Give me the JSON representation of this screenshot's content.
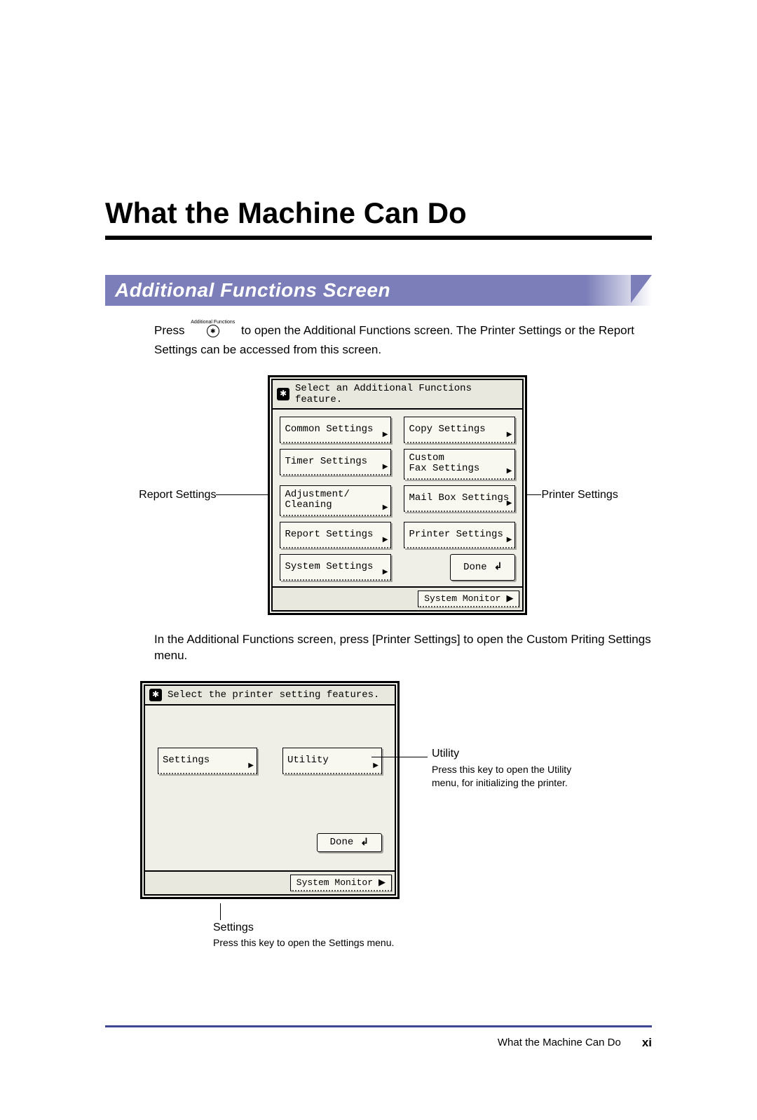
{
  "title": "What the Machine Can Do",
  "section_heading": "Additional Functions Screen",
  "intro_a": "Press",
  "intro_b": "to open the Additional Functions screen. The Printer Settings or the Report Settings can be accessed from this screen.",
  "icon_label": "Additional Functions",
  "callouts": {
    "report_settings": "Report Settings",
    "printer_settings": "Printer Settings"
  },
  "lcd1": {
    "header": "Select an Additional Functions feature.",
    "buttons": [
      "Common Settings",
      "Copy Settings",
      "Timer Settings",
      "Custom\nFax Settings",
      "Adjustment/\nCleaning",
      "Mail Box Settings",
      "Report Settings",
      "Printer Settings",
      "System Settings"
    ],
    "done": "Done",
    "system_monitor": "System Monitor"
  },
  "mid_text": "In the Additional Functions screen, press [Printer Settings] to open the Custom Priting Settings menu.",
  "lcd2": {
    "header": "Select the printer setting features.",
    "settings_btn": "Settings",
    "utility_btn": "Utility",
    "done": "Done",
    "system_monitor": "System Monitor"
  },
  "utility_callout": {
    "title": "Utility",
    "desc": "Press this key to open the Utility menu, for initializing the printer."
  },
  "settings_callout": {
    "title": "Settings",
    "desc": "Press this key to open the Settings menu."
  },
  "footer": {
    "label": "What the Machine Can Do",
    "page": "xi"
  }
}
